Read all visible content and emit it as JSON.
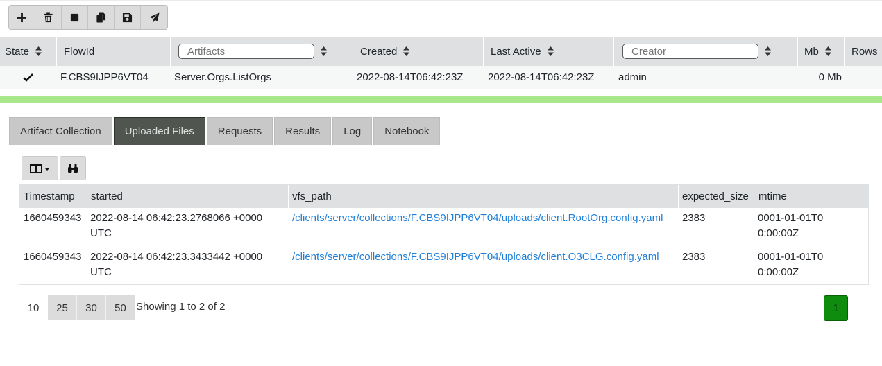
{
  "toolbar": {
    "buttons": [
      {
        "icon": "plus-icon"
      },
      {
        "icon": "trash-icon"
      },
      {
        "icon": "stop-icon"
      },
      {
        "icon": "copy-icon"
      },
      {
        "icon": "save-icon"
      },
      {
        "icon": "send-icon"
      }
    ]
  },
  "flows": {
    "headers": {
      "state": "State",
      "flowid": "FlowId",
      "artifacts_placeholder": "Artifacts",
      "created": "Created",
      "last_active": "Last Active",
      "creator_placeholder": "Creator",
      "mb": "Mb",
      "rows": "Rows"
    },
    "row": {
      "state_icon": "check-icon",
      "flowid": "F.CBS9IJPP6VT04",
      "artifacts": "Server.Orgs.ListOrgs",
      "created": "2022-08-14T06:42:23Z",
      "last_active": "2022-08-14T06:42:23Z",
      "creator": "admin",
      "mb": "0 Mb"
    }
  },
  "tabs": [
    {
      "label": "Artifact Collection",
      "active": false
    },
    {
      "label": "Uploaded Files",
      "active": true
    },
    {
      "label": "Requests",
      "active": false
    },
    {
      "label": "Results",
      "active": false
    },
    {
      "label": "Log",
      "active": false
    },
    {
      "label": "Notebook",
      "active": false
    }
  ],
  "table_toolbar": {
    "columns_icon": "columns-dropdown-icon",
    "search_icon": "binoculars-icon"
  },
  "files": {
    "columns": [
      "Timestamp",
      "started",
      "vfs_path",
      "expected_size",
      "mtime"
    ],
    "rows": [
      {
        "timestamp": "1660459343",
        "started": "2022-08-14 06:42:23.2768066 +0000 UTC",
        "vfs_path": "/clients/server/collections/F.CBS9IJPP6VT04/uploads/client.RootOrg.config.yaml",
        "expected_size": "2383",
        "mtime": "0001-01-01T00:00:00Z"
      },
      {
        "timestamp": "1660459343",
        "started": "2022-08-14 06:42:23.3433442 +0000 UTC",
        "vfs_path": "/clients/server/collections/F.CBS9IJPP6VT04/uploads/client.O3CLG.config.yaml",
        "expected_size": "2383",
        "mtime": "0001-01-01T00:00:00Z"
      }
    ]
  },
  "pagination": {
    "sizes": [
      "10",
      "25",
      "30",
      "50"
    ],
    "showing": "Showing 1 to 2 of 2",
    "current_page": "1",
    "active_color": "#0e8c0e"
  },
  "colors": {
    "accent_green_bar": "#a8e88a",
    "link": "#1f7fd8",
    "active_tab": "#505550"
  }
}
